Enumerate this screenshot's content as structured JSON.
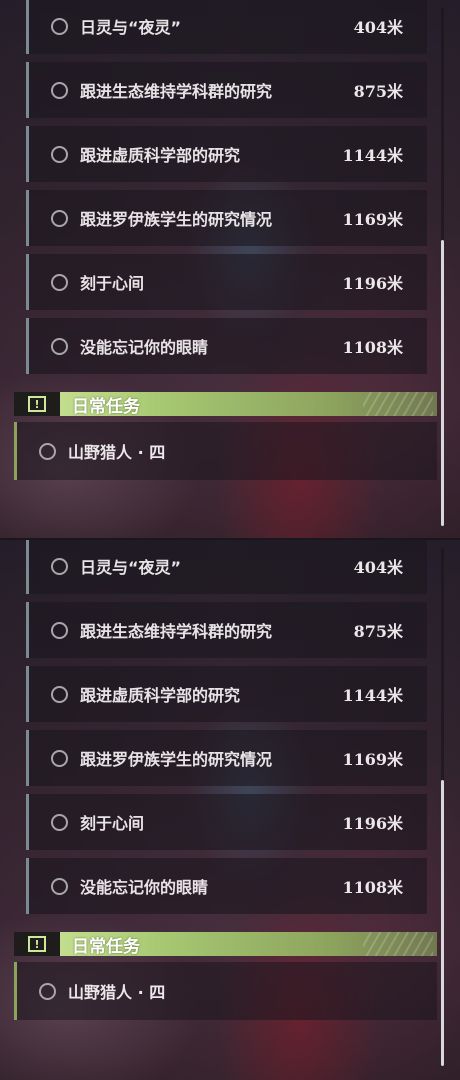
{
  "panels": [
    {
      "quests": [
        {
          "name": "日灵与“夜灵”",
          "distance": "404米"
        },
        {
          "name": "跟进生态维持学科群的研究",
          "distance": "875米"
        },
        {
          "name": "跟进虚质科学部的研究",
          "distance": "1144米"
        },
        {
          "name": "跟进罗伊族学生的研究情况",
          "distance": "1169米"
        },
        {
          "name": "刻于心间",
          "distance": "1196米"
        },
        {
          "name": "没能忘记你的眼睛",
          "distance": "1108米"
        }
      ],
      "section_title": "日常任务",
      "daily": [
        {
          "name": "山野猎人 · 四"
        }
      ]
    },
    {
      "quests": [
        {
          "name": "日灵与“夜灵”",
          "distance": "404米"
        },
        {
          "name": "跟进生态维持学科群的研究",
          "distance": "875米"
        },
        {
          "name": "跟进虚质科学部的研究",
          "distance": "1144米"
        },
        {
          "name": "跟进罗伊族学生的研究情况",
          "distance": "1169米"
        },
        {
          "name": "刻于心间",
          "distance": "1196米"
        },
        {
          "name": "没能忘记你的眼睛",
          "distance": "1108米"
        }
      ],
      "section_title": "日常任务",
      "daily": [
        {
          "name": "山野猎人 · 四"
        }
      ]
    }
  ],
  "colors": {
    "section_accent": "#cfe79a",
    "quest_border": "#7b8a94",
    "daily_border": "#8ba35a"
  },
  "icons": {
    "quest_status": "circle-outline-icon",
    "section_icon": "exclamation-box-icon"
  }
}
